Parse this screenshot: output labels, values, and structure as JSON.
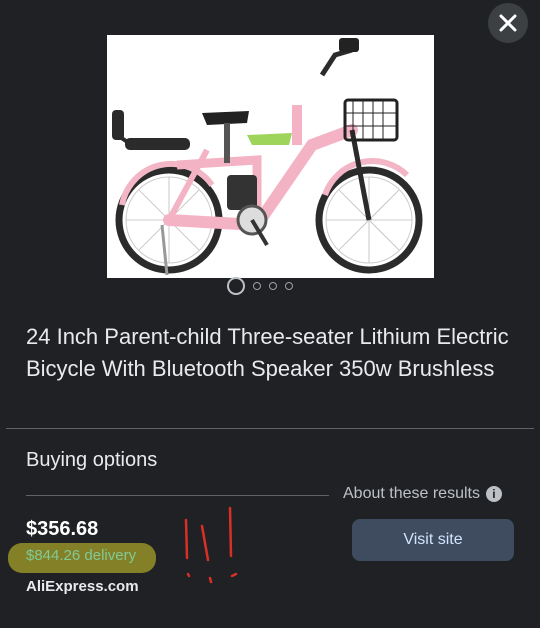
{
  "product": {
    "title": "24 Inch Parent-child Three-seater Lithium Electric Bicycle With Bluetooth Speaker 350w Brushless",
    "image_icon": "pink-electric-bicycle-image",
    "carousel": {
      "count": 4,
      "active_index": 0
    }
  },
  "buying": {
    "heading": "Buying options",
    "about_label": "About these results",
    "price": "$356.68",
    "delivery": "$844.26 delivery",
    "seller": "AliExpress.com",
    "visit_label": "Visit site"
  },
  "icons": {
    "close": "close-icon",
    "info": "info-icon"
  },
  "colors": {
    "background": "#202124",
    "delivery_text": "#81c995",
    "highlight_marker": "#a4a02a",
    "annotation_ink": "#d93025",
    "button_bg": "#3f4c5f"
  }
}
